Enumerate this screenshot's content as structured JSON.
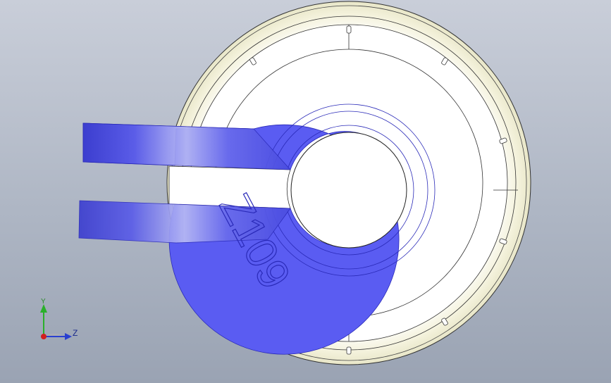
{
  "viewport": {
    "background_top": "#c9ced9",
    "background_bottom": "#9aa3b3"
  },
  "model": {
    "engraved_text": "Z109",
    "body_color": "#ffffff",
    "rim_shade_color": "#f2f0d8",
    "insert_color": "#5a5cf2",
    "insert_edge_color": "#3a3ad8",
    "edge_color": "#1a1a1a"
  },
  "triad": {
    "y_label": "Y",
    "z_label": "Z",
    "y_color": "#2ab02a",
    "z_color": "#2a40d0",
    "x_color": "#d02020"
  }
}
